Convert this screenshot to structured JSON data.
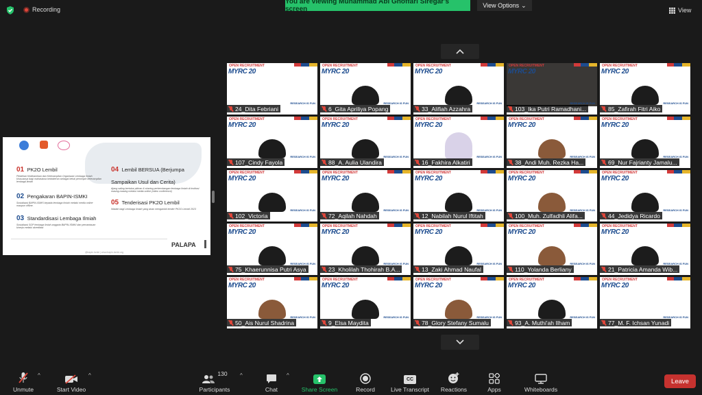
{
  "top": {
    "recording_label": "Recording",
    "banner_text": "You are viewing Muhammad Abi Ghoffari Siregar's screen",
    "view_options_label": "View Options",
    "view_label": "View"
  },
  "shared_screen": {
    "items": [
      {
        "num": "01",
        "title": "PK2O Lembil",
        "desc": "Pelatihan Kedinamikan dan Keterampilan Organisasi Lembaga Ilmiah khususnya bagi mahasiswa kedokteran sebagai bekal pemimpin keterampilan lembaga ilmiah"
      },
      {
        "num": "02",
        "title": "Pengakaran BAPIN-ISMKI",
        "desc": "Sosialisasi BAPIN-ISMKI kepada lembaga ilmiah melalui media online maupun offline."
      },
      {
        "num": "03",
        "title": "Standardisasi Lembaga Ilmiah",
        "desc": "Sosialisasi SOP lembaga ilmiah anggota BAPIN-ISMKI dan pemantauan kinerja melalui akreditasi"
      },
      {
        "num": "04",
        "title": "Lembil BERSUA (Berjumpa Sampaikan Usul dan Cerita)",
        "desc": "Ajang saling bertukar pikiran & sharing perkembangan lembaga ilmiah di institusi masing-masing melalui media online (video conference)"
      },
      {
        "num": "05",
        "title": "Tenderisasi PK2O Lembil",
        "desc": "Wadah bagi Lembaga ilmiah yang akan mengambil tender PK2O Lembil 2023"
      }
    ],
    "brand": "PALAPA",
    "footer": "@bapin.ismki | www.bapin-ismki.org"
  },
  "tile_brand": {
    "top": "OPEN RECRUITMENT",
    "main": "MYRC 20",
    "tagline": "RESEARCH IS FUN"
  },
  "participants_grid": [
    {
      "name": "24_Dita Febriani",
      "look": "none"
    },
    {
      "name": "6_Gita Apriliya Popang",
      "look": "dark"
    },
    {
      "name": "33_Alifiah Azzahra",
      "look": "dark"
    },
    {
      "name": "103_Ika Putri Ramadhani...",
      "look": "photo"
    },
    {
      "name": "85_Zafirah Fitri Aiko",
      "look": "dark"
    },
    {
      "name": "107_Cindy Fayola",
      "look": "dark"
    },
    {
      "name": "88_A. Aulia Ulandira",
      "look": "dark"
    },
    {
      "name": "16_Fakhira Alkatiri",
      "look": "hijab"
    },
    {
      "name": "38_Andi Muh. Rezka Ha...",
      "look": "skin"
    },
    {
      "name": "69_Nur Fajrianty Jamalu...",
      "look": "dark"
    },
    {
      "name": "102_Victoria",
      "look": "dark"
    },
    {
      "name": "72_Aqilah Nahdah",
      "look": "dark"
    },
    {
      "name": "12_Nabilah Nurul Iftitah",
      "look": "dark"
    },
    {
      "name": "100_Muh. Zulfadhli Alifa...",
      "look": "skin"
    },
    {
      "name": "44_Jedidya Ricardo",
      "look": "dark"
    },
    {
      "name": "75_Khaerunnisa Putri Asya",
      "look": "dark"
    },
    {
      "name": "23_Kholilah Thohirah B.A...",
      "look": "dark"
    },
    {
      "name": "13_Zaki Ahmad Naufal",
      "look": "dark"
    },
    {
      "name": "110_Yolanda Berliany",
      "look": "skin"
    },
    {
      "name": "21_Patricia Amanda Wib...",
      "look": "dark"
    },
    {
      "name": "50_Ais Nurul Shadrina",
      "look": "skin"
    },
    {
      "name": "9_Elsa Maydita",
      "look": "dark"
    },
    {
      "name": "78_Glory Stefany Sumalu",
      "look": "skin"
    },
    {
      "name": "93_A. Muthi'ah Ilham",
      "look": "dark"
    },
    {
      "name": "77_M. F. Ichsan Yunadi",
      "look": "none"
    }
  ],
  "toolbar": {
    "unmute": "Unmute",
    "start_video": "Start Video",
    "participants": "Participants",
    "participants_count": "130",
    "chat": "Chat",
    "share_screen": "Share Screen",
    "record": "Record",
    "live_transcript": "Live Transcript",
    "reactions": "Reactions",
    "apps": "Apps",
    "whiteboards": "Whiteboards",
    "leave": "Leave",
    "cc_glyph": "CC"
  },
  "colors": {
    "accent_green": "#26c26a",
    "leave_red": "#c6322f",
    "muted_red": "#e0463a"
  }
}
